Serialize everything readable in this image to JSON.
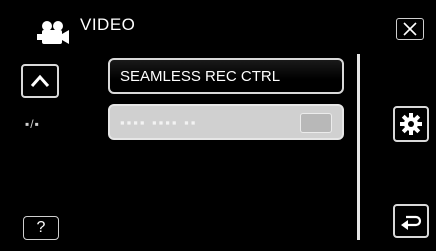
{
  "header": {
    "title": "VIDEO",
    "icon": "video-camera-icon"
  },
  "menu": {
    "items": [
      {
        "label": "SEAMLESS REC CTRL",
        "enabled": true
      },
      {
        "label": "▪▪▪▪ ▪▪▪▪ ▪▪",
        "enabled": false
      }
    ]
  },
  "nav": {
    "page_indicator": "▪/▪",
    "help_label": "?"
  },
  "icons": {
    "close": "close-icon",
    "up": "chevron-up-icon",
    "gear": "gear-icon",
    "back": "return-arrow-icon"
  },
  "colors": {
    "background": "#000000",
    "border": "#d9d9d9",
    "disabled_item": "#d0d0d0"
  }
}
